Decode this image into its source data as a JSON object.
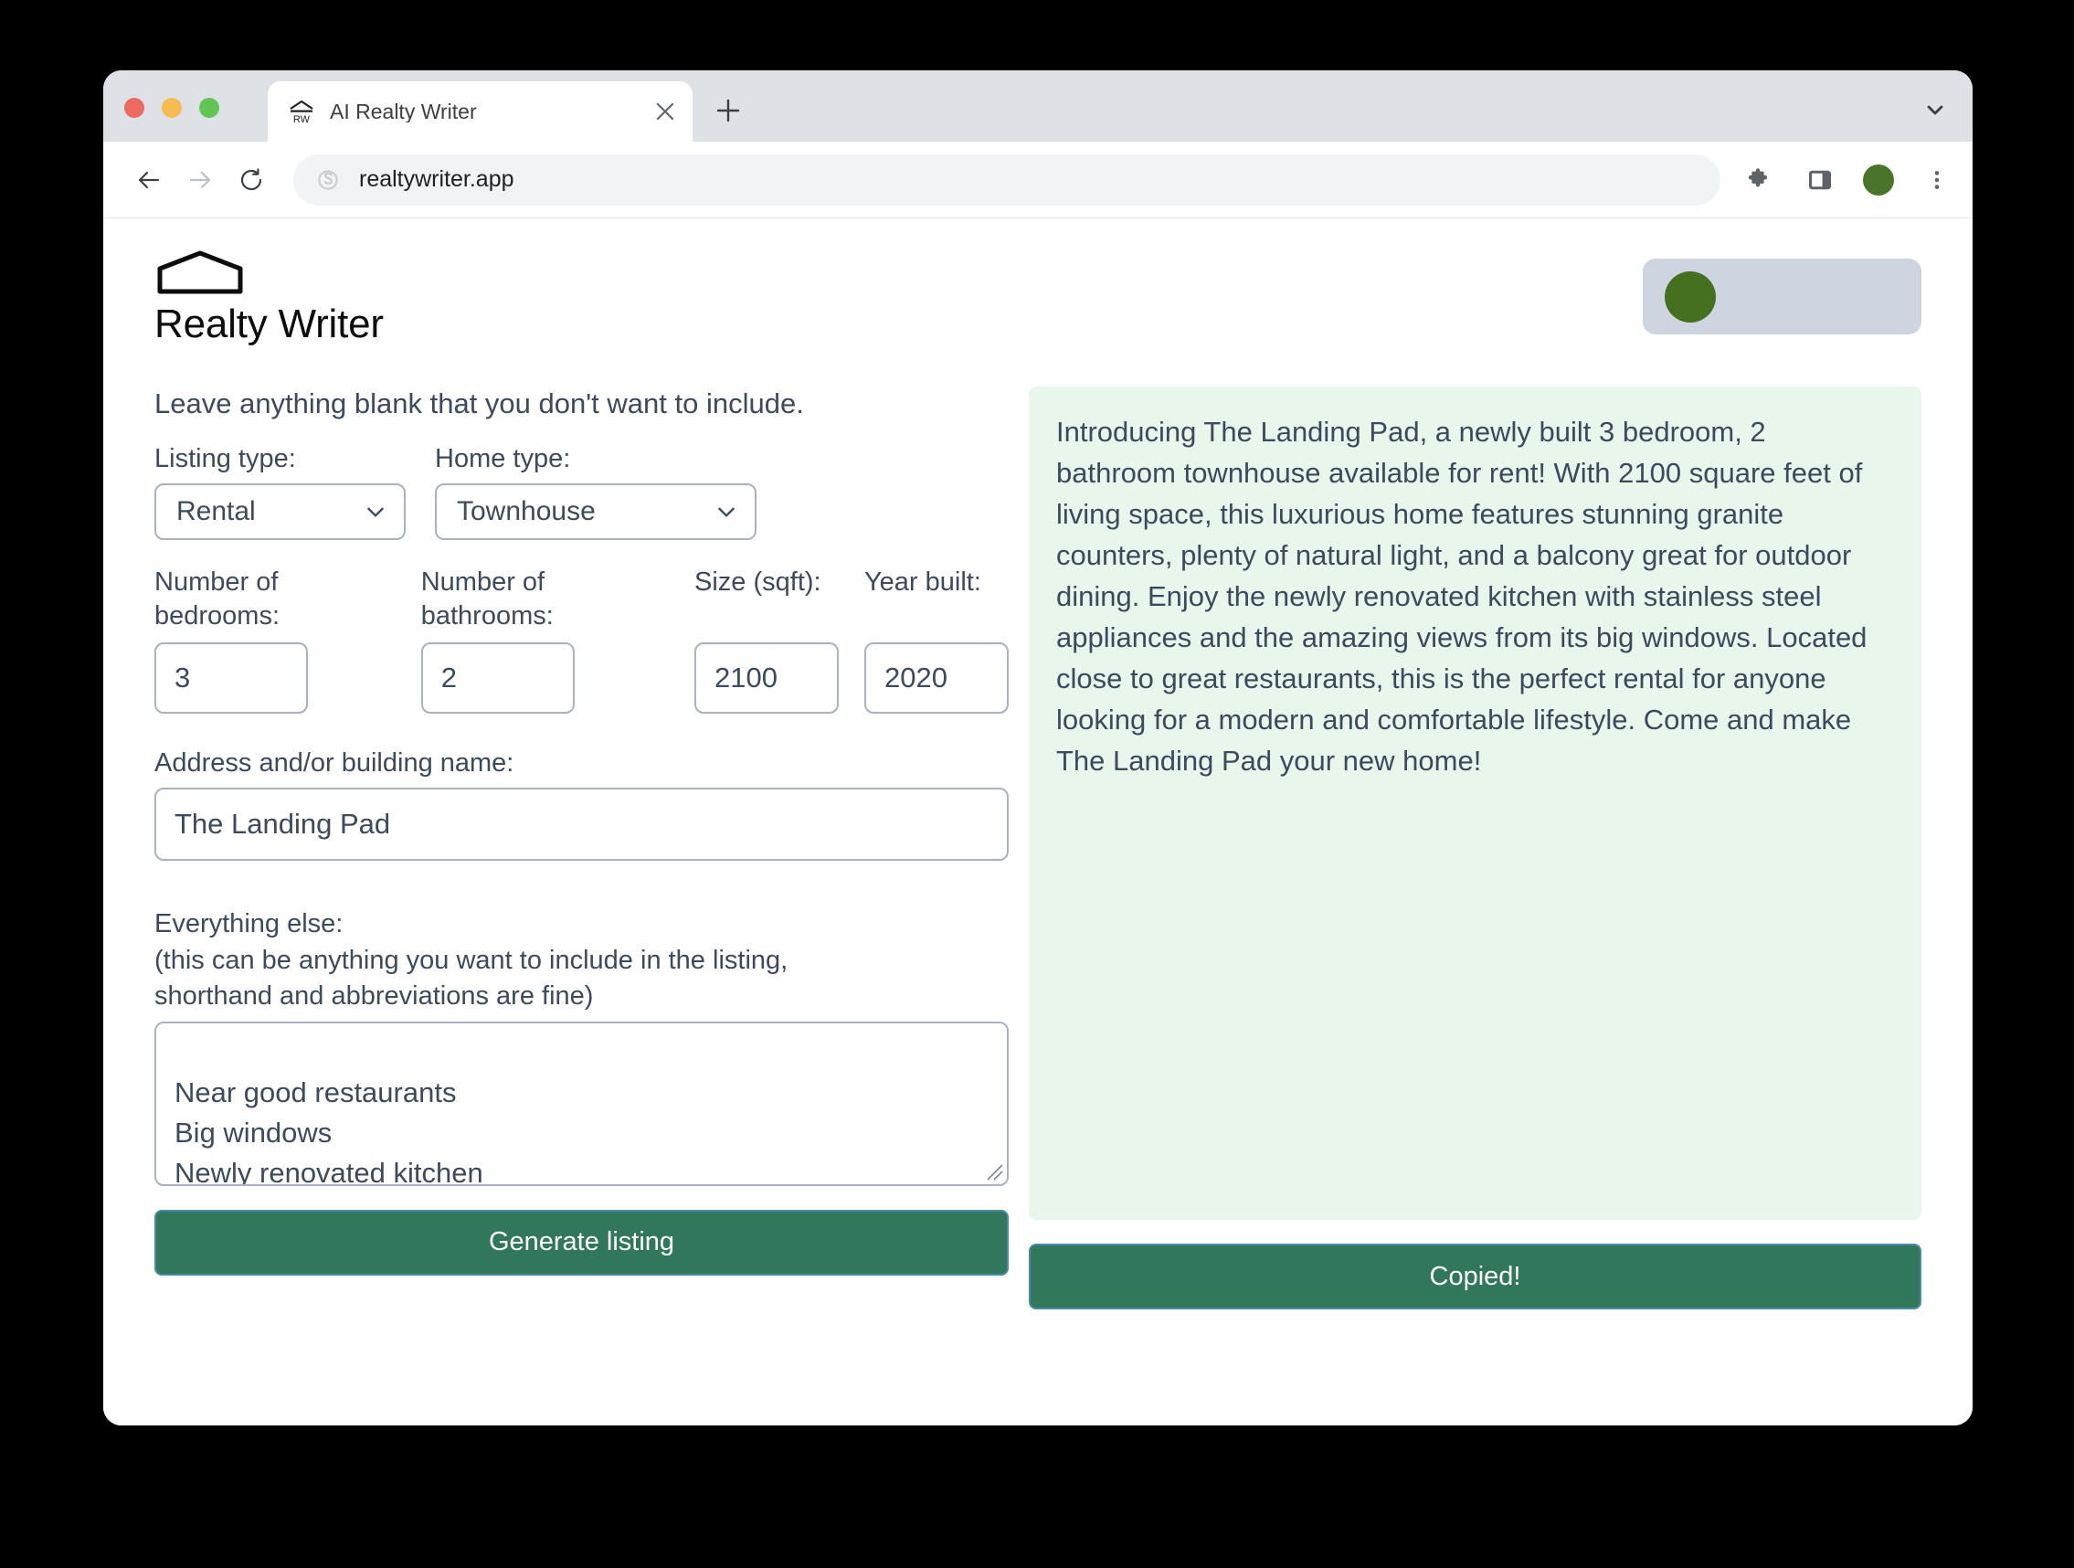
{
  "browser": {
    "tab": {
      "title": "AI Realty Writer",
      "favicon_name": "realty-writer-house-rw-favicon",
      "close_label": "×"
    },
    "new_tab_label": "+",
    "omnibox": {
      "url": "realtywriter.app",
      "icon_name": "site-info-icon"
    },
    "toolbar_icons": [
      "extensions-puzzle-icon",
      "side-panel-icon",
      "profile-avatar",
      "chrome-menu-icon"
    ],
    "tabstrip_chevron_name": "tab-list-chevron-down-icon"
  },
  "app": {
    "brand_name": "Realty Writer",
    "brand_mark_name": "house-outline-logo",
    "account_widget": {
      "avatar_color": "#44701f",
      "background_color": "#ced5e0"
    },
    "hint": "Leave anything blank that you don't want to include.",
    "fields": {
      "listing_type": {
        "label": "Listing type:",
        "value": "Rental",
        "options": [
          "Rental"
        ]
      },
      "home_type": {
        "label": "Home type:",
        "value": "Townhouse",
        "options": [
          "Townhouse"
        ]
      },
      "bedrooms": {
        "label": "Number of bedrooms:",
        "value": "3"
      },
      "bathrooms": {
        "label": "Number of bathrooms:",
        "value": "2"
      },
      "size": {
        "label": "Size (sqft):",
        "value": "2100"
      },
      "year_built": {
        "label": "Year built:",
        "value": "2020"
      },
      "address": {
        "label": "Address and/or building name:",
        "value": "The Landing Pad"
      },
      "everything_else": {
        "label_line1": "Everything else:",
        "label_line2": "(this can be anything you want to include in the listing,",
        "label_line3": "shorthand and abbreviations are fine)",
        "value": "Near good restaurants\nBig windows\nNewly renovated kitchen\nStainless apps"
      }
    },
    "buttons": {
      "generate": "Generate listing",
      "copy": "Copied!"
    },
    "output": {
      "text": "Introducing The Landing Pad, a newly built 3 bedroom, 2 bathroom townhouse available for rent! With 2100 square feet of living space, this luxurious home features stunning granite counters, plenty of natural light, and a balcony great for outdoor dining. Enjoy the newly renovated kitchen with stainless steel appliances and the amazing views from its big windows. Located close to great restaurants, this is the perfect rental for anyone looking for a modern and comfortable lifestyle. Come and make The Landing Pad your new home!",
      "background_color": "#e9f6ec"
    },
    "accent_color": "#31775b"
  }
}
